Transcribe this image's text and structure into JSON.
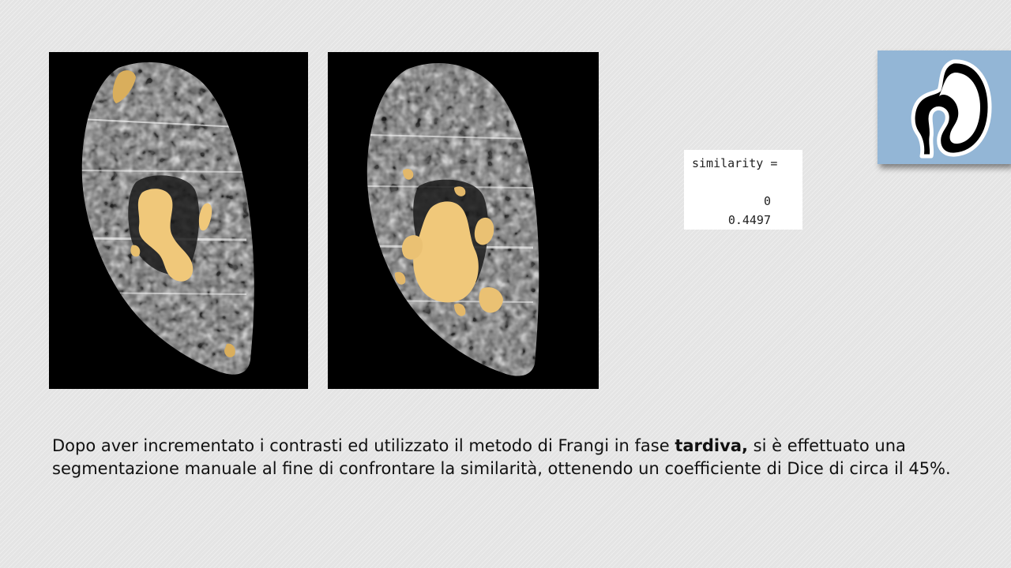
{
  "slide": {
    "similarity_output": {
      "label": "similarity =",
      "values": [
        "0",
        "0.4497"
      ]
    },
    "caption": {
      "before_bold": "Dopo aver incrementato i contrasti ed utilizzato il metodo di Frangi in fase ",
      "bold": "tardiva,",
      "after_bold": " si è effettuato una segmentazione manuale al fine di confrontare la similarità, ottenendo un coefficiente di Dice di circa il 45%."
    },
    "logo_icon": "kidney-icon",
    "colors": {
      "background": "#e4e4e4",
      "segmentation_overlay": "#f0c87a",
      "logo_background": "#93b6d6"
    }
  }
}
